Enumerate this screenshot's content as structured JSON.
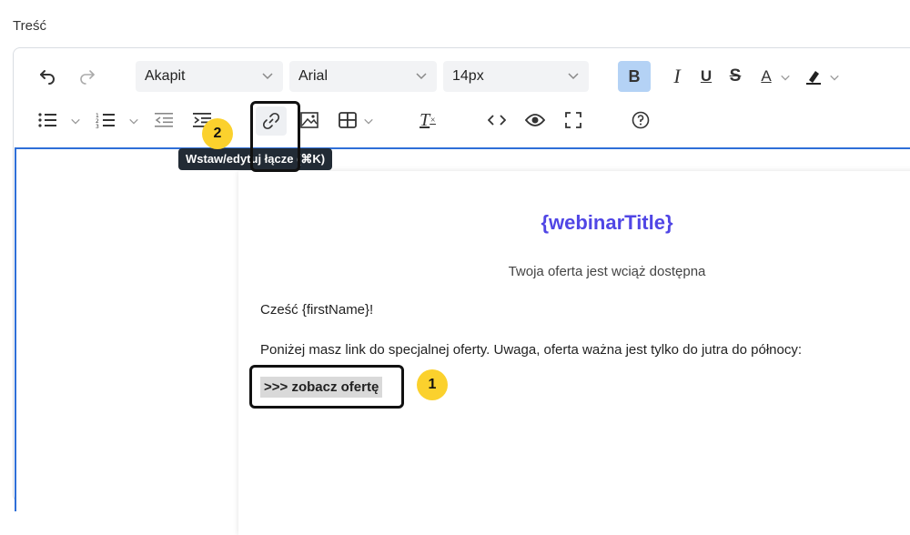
{
  "field": {
    "label": "Treść"
  },
  "toolbar": {
    "block_format": "Akapit",
    "font_family": "Arial",
    "font_size": "14px",
    "bold_label": "B",
    "italic_label": "I",
    "underline_label": "U",
    "strike_label": "S",
    "text_color_label": "A",
    "clear_format_label": "T",
    "icons": [
      "undo-icon",
      "redo-icon",
      "bullet-list-icon",
      "numbered-list-icon",
      "outdent-icon",
      "indent-icon",
      "link-icon",
      "image-icon",
      "table-icon",
      "clear-formatting-icon",
      "code-icon",
      "preview-icon",
      "fullscreen-icon",
      "help-icon",
      "highlight-icon"
    ]
  },
  "tooltip": {
    "text": "Wstaw/edytuj łącze (⌘K)"
  },
  "email": {
    "title": "{webinarTitle}",
    "subtitle": "Twoja oferta jest wciąż dostępna",
    "greeting": "Cześć {firstName}!",
    "body": "Poniżej masz link do specjalnej oferty. Uwaga, oferta ważna jest tylko do jutra do północy:",
    "link_text": ">>> zobacz ofertę"
  },
  "callouts": {
    "badge_1": "1",
    "badge_2": "2"
  },
  "colors": {
    "accent_blue": "#2f6fd8",
    "title_purple": "#5046e5",
    "badge_yellow": "#fbd12d",
    "bold_active": "#b4d2f5",
    "tooltip_bg": "#222b35"
  }
}
